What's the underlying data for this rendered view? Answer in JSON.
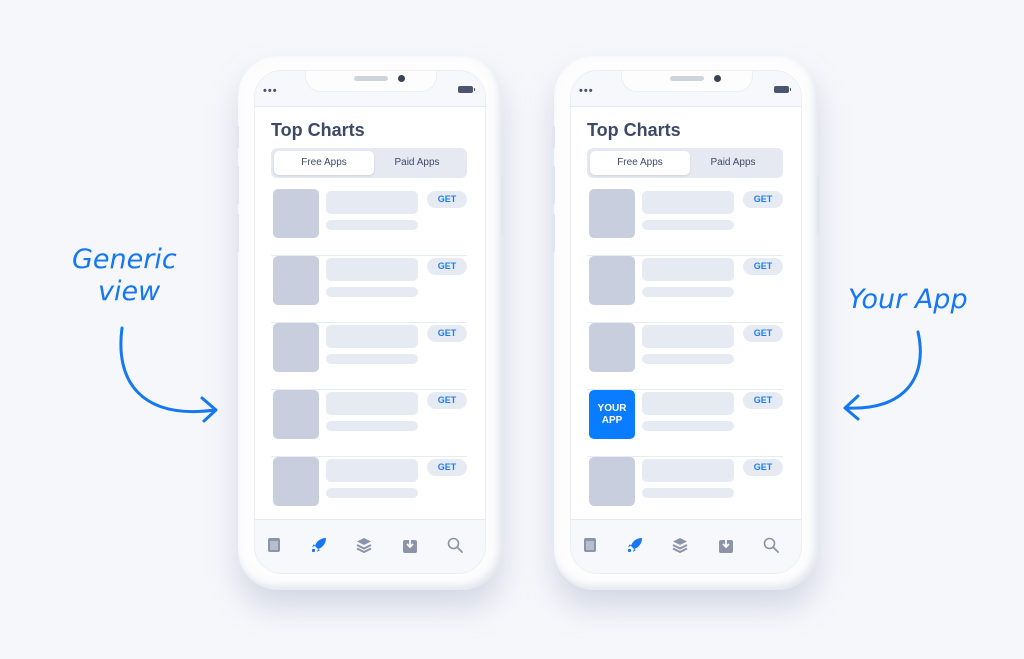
{
  "annotations": {
    "left_line1": "Generic",
    "left_line2": "view",
    "right": "Your App"
  },
  "phones": [
    {
      "title": "Top Charts",
      "tabs": [
        "Free Apps",
        "Paid Apps"
      ],
      "rows": [
        {
          "get": "GET",
          "icon_label": ""
        },
        {
          "get": "GET",
          "icon_label": ""
        },
        {
          "get": "GET",
          "icon_label": ""
        },
        {
          "get": "GET",
          "icon_label": ""
        },
        {
          "get": "GET",
          "icon_label": ""
        }
      ],
      "status_dots": "•••"
    },
    {
      "title": "Top Charts",
      "tabs": [
        "Free Apps",
        "Paid Apps"
      ],
      "rows": [
        {
          "get": "GET",
          "icon_label": ""
        },
        {
          "get": "GET",
          "icon_label": ""
        },
        {
          "get": "GET",
          "icon_label": ""
        },
        {
          "get": "GET",
          "icon_label": "YOUR APP"
        },
        {
          "get": "GET",
          "icon_label": ""
        }
      ],
      "status_dots": "•••"
    }
  ],
  "tabbar_icons": [
    "today-icon",
    "apps-rocket-icon",
    "layers-icon",
    "updates-download-icon",
    "search-icon"
  ],
  "colors": {
    "accent": "#0a7cff",
    "text": "#3d4a66",
    "placeholder": "#e6eaf3",
    "icon_placeholder": "#c8cede"
  }
}
